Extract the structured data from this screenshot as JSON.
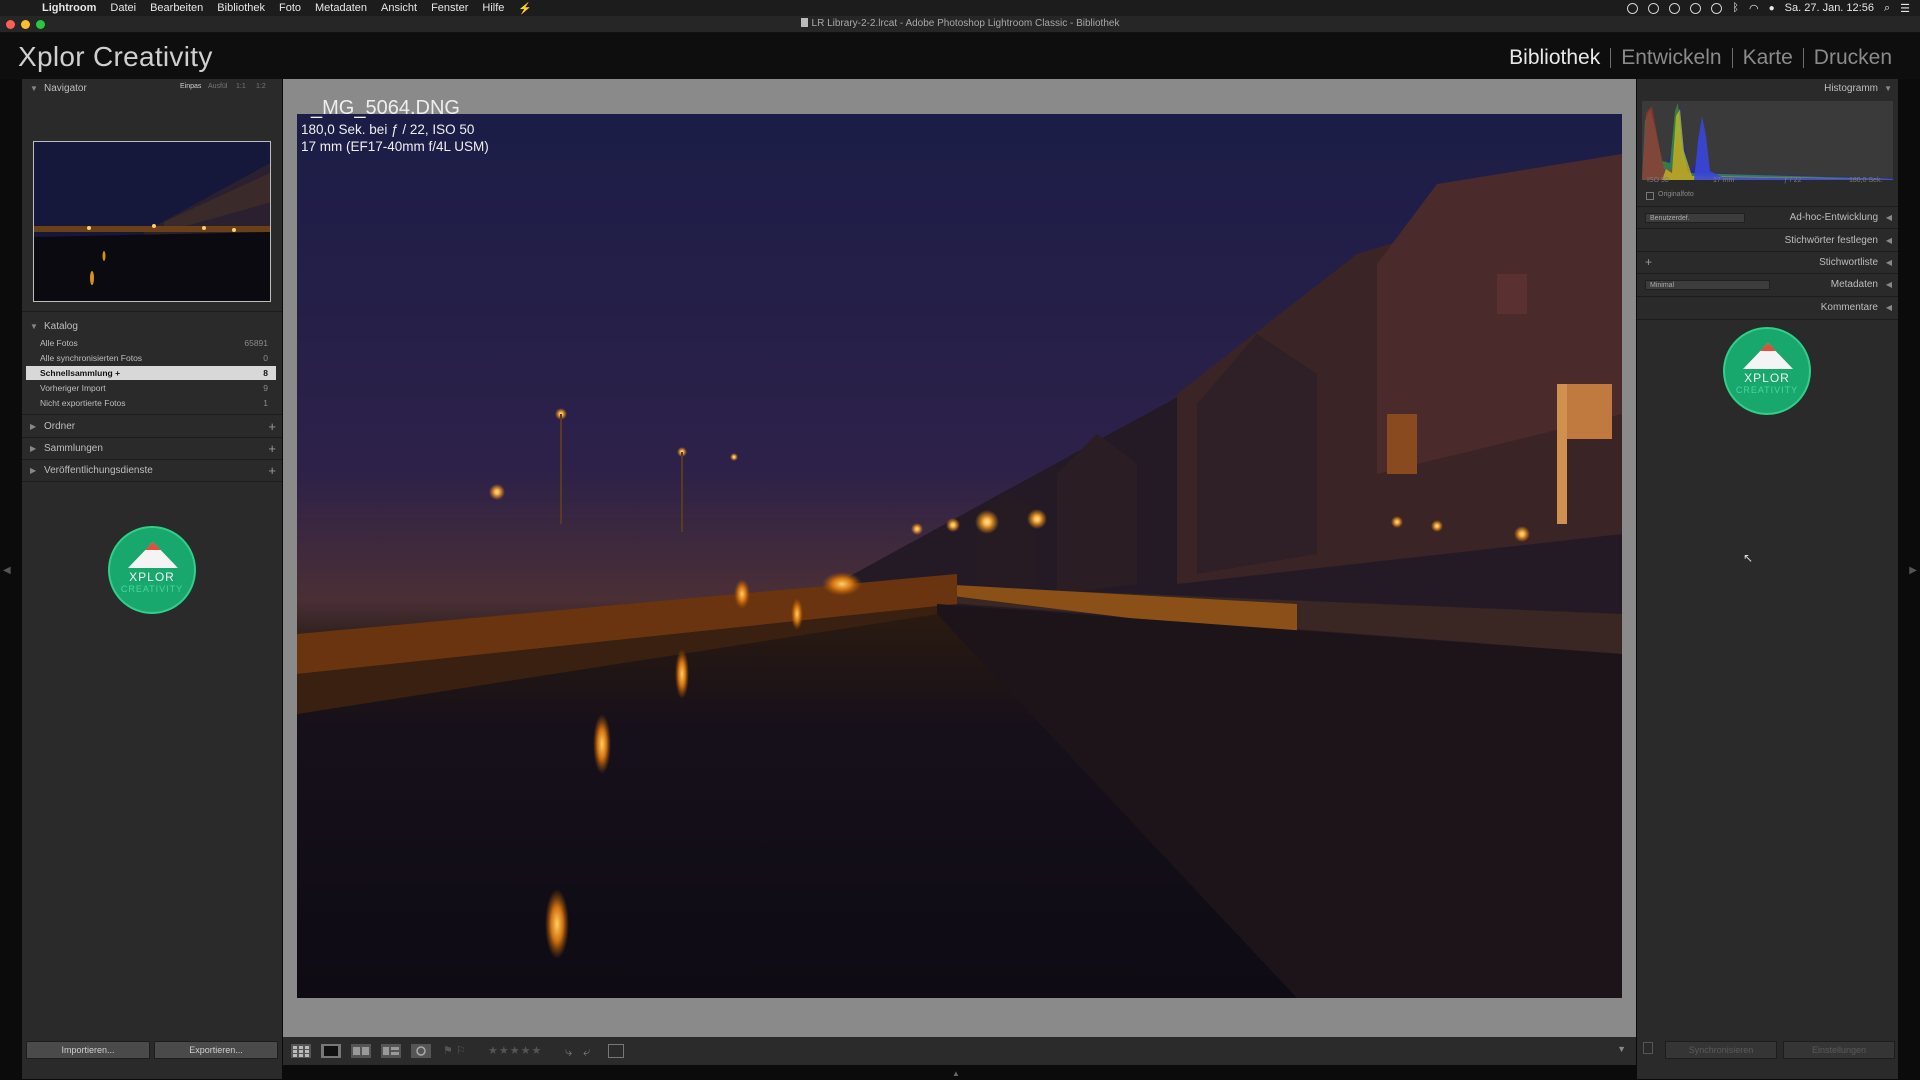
{
  "menubar": {
    "app": "Lightroom",
    "items": [
      "Datei",
      "Bearbeiten",
      "Bibliothek",
      "Foto",
      "Metadaten",
      "Ansicht",
      "Fenster",
      "Hilfe"
    ],
    "datetime": "Sa. 27. Jan. 12:56"
  },
  "window": {
    "title": "LR Library-2-2.lrcat - Adobe Photoshop Lightroom Classic - Bibliothek"
  },
  "identity_plate": "Xplor Creativity",
  "modules": {
    "items": [
      "Bibliothek",
      "Entwickeln",
      "Karte",
      "Drucken"
    ],
    "active": "Bibliothek"
  },
  "left_panel": {
    "navigator": {
      "title": "Navigator",
      "zoom_options": [
        "Einpas",
        "Ausfül",
        "1:1",
        "1:2"
      ]
    },
    "catalog": {
      "title": "Katalog",
      "rows": [
        {
          "name": "Alle Fotos",
          "count": "65891"
        },
        {
          "name": "Alle synchronisierten Fotos",
          "count": "0"
        },
        {
          "name": "Schnellsammlung +",
          "count": "8"
        },
        {
          "name": "Vorheriger Import",
          "count": "9"
        },
        {
          "name": "Nicht exportierte Fotos",
          "count": "1"
        }
      ]
    },
    "folders": "Ordner",
    "collections": "Sammlungen",
    "publish": "Veröffentlichungsdienste",
    "import_label": "Importieren...",
    "export_label": "Exportieren..."
  },
  "logo": {
    "line1": "XPLOR",
    "line2": "CREATIVITY"
  },
  "photo_info": {
    "filename": "_MG_5064.DNG",
    "exposure": "180,0 Sek. bei ƒ / 22, ISO 50",
    "lens": "17 mm (EF17-40mm f/4L USM)"
  },
  "right_panel": {
    "histogram": {
      "title": "Histogramm",
      "iso": "ISO 50",
      "focal": "17 mm",
      "aperture": "ƒ / 22",
      "shutter": "180,0 Sek.",
      "original_label": "Originalfoto"
    },
    "quick_develop": {
      "title": "Ad-hoc-Entwicklung",
      "preset": "Benutzerdef."
    },
    "keywording": "Stichwörter festlegen",
    "keyword_list": "Stichwortliste",
    "metadata": {
      "title": "Metadaten",
      "preset": "Minimal"
    },
    "comments": "Kommentare",
    "sync_metadata": "Synchronisieren",
    "sync_settings": "Einstellungen"
  },
  "toolbar": {
    "rating_stars": "★★★★★",
    "rating": 0
  },
  "colors": {
    "accent_logo": "#18a86e",
    "panel": "#2a2a2a",
    "center_bg": "#8a8a8a"
  }
}
